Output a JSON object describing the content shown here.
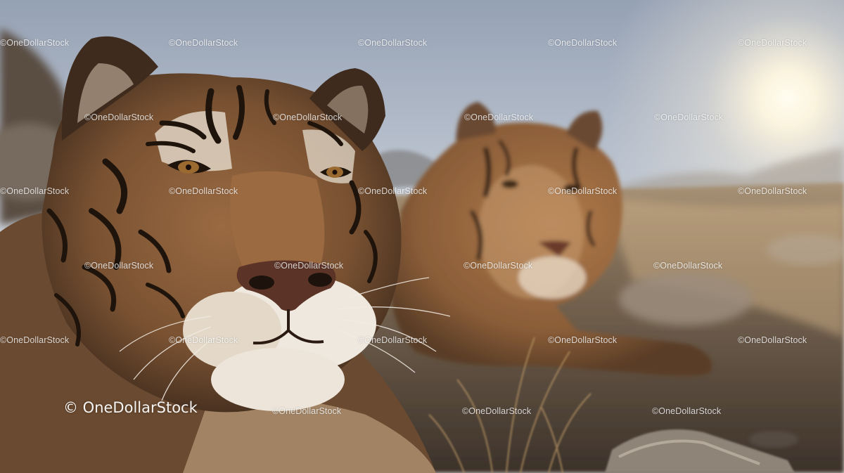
{
  "image": {
    "subject": "tigers",
    "colors": {
      "sky_top": "#9aa6b8",
      "sky_horizon": "#dfe4ea",
      "sun": "#fffbea",
      "fur": "#8a5a34",
      "fur_light": "#c9a886",
      "ground": "#4a3e33"
    }
  },
  "watermark": {
    "text": "©OneDollarStock",
    "main_text": "© OneDollarStock"
  }
}
